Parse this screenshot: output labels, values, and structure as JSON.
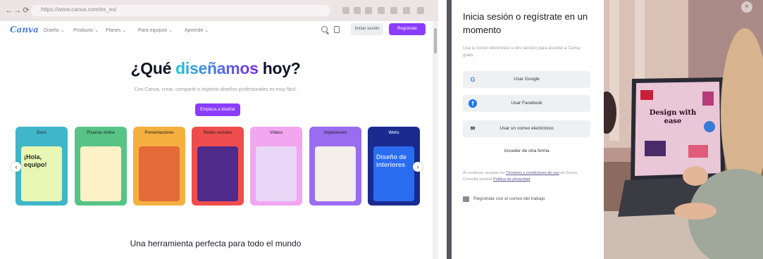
{
  "browser": {
    "url": "https://www.canva.com/es_es/",
    "nav_back": "←",
    "nav_forward": "→",
    "nav_reload": "⟳"
  },
  "site": {
    "logo": "Canva",
    "menu": [
      "Diseño ⌄",
      "Producto ⌄",
      "Planes ⌄",
      "Para equipos ⌄",
      "Aprende ⌄"
    ],
    "login_label": "Iniciar sesión",
    "signup_label": "Regístrate",
    "hero_prefix": "¿Qué ",
    "hero_highlight": "diseñamos",
    "hero_suffix": " hoy?",
    "hero_subtitle": "Con Canva, crear, compartir e imprimir diseños profesionales es muy fácil.",
    "hero_cta": "Empieza a diseñar",
    "cards": [
      {
        "label": "Docs",
        "bg": "#3fb6c9",
        "art": "#e9f7b4",
        "art_text": "¡Hola, equipo!"
      },
      {
        "label": "Pizarras online",
        "bg": "#57c486",
        "art": "#fdf1c8",
        "art_text": ""
      },
      {
        "label": "Presentaciones",
        "bg": "#f5b040",
        "art": "#e56a3a",
        "art_text": ""
      },
      {
        "label": "Redes sociales",
        "bg": "#ef4d4d",
        "art": "#4f2a8b",
        "art_text": ""
      },
      {
        "label": "Vídeos",
        "bg": "#f2a6f0",
        "art": "#e9d7f7",
        "art_text": ""
      },
      {
        "label": "Impresiones",
        "bg": "#9a6cf0",
        "art": "#f4efe8",
        "art_text": ""
      },
      {
        "label": "Webs",
        "bg": "#1a2a8f",
        "art": "#2a6cf0",
        "art_text": "Diseño de interiores"
      }
    ],
    "section_title": "Una herramienta perfecta para todo el mundo"
  },
  "modal": {
    "title": "Inicia sesión o regístrate en un momento",
    "subtitle": "Usa tu correo electrónico u otro servicio para acceder a Canva gratis.",
    "google_label": "Usar Google",
    "facebook_label": "Usar Facebook",
    "email_label": "Usar un correo electrónico",
    "other_way": "Acceder de otra forma",
    "legal_prefix": "Al continuar, aceptas los ",
    "legal_link1": "Términos y condiciones de uso",
    "legal_mid": " de Canva. Consulta nuestra ",
    "legal_link2": "Política de privacidad",
    "legal_suffix": ".",
    "work_signup": "Regístrate con el correo del trabajo",
    "close": "×"
  },
  "photo": {
    "laptop_text": "Design with ease"
  }
}
